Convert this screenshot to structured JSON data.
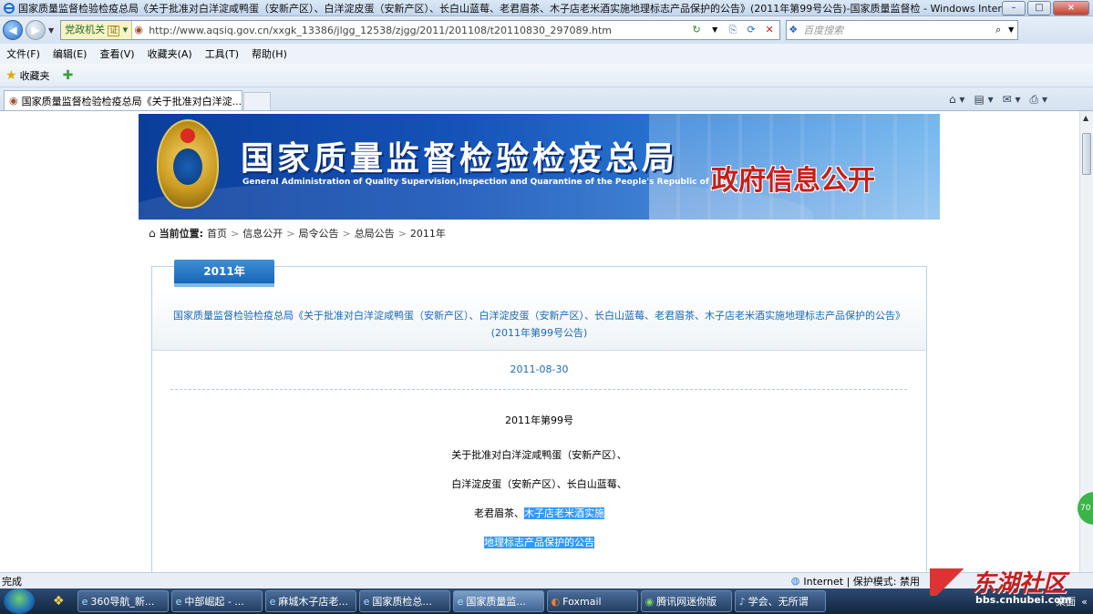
{
  "window": {
    "title": "国家质量监督检验检疫总局《关于批准对白洋淀咸鸭蛋（安新产区）、白洋淀皮蛋（安新产区）、长白山蓝莓、老君眉茶、木子店老米酒实施地理标志产品保护的公告》(2011年第99号公告)-国家质量监督检 - Windows Internet E...",
    "minimize": "–",
    "maximize": "□",
    "close": "×"
  },
  "address": {
    "gov_label": "党政机关",
    "cert_label": "证",
    "url": "http://www.aqsiq.gov.cn/xxgk_13386/jlgg_12538/zjgg/2011/201108/t20110830_297089.htm",
    "search_placeholder": "百度搜索"
  },
  "menu": [
    "文件(F)",
    "编辑(E)",
    "查看(V)",
    "收藏夹(A)",
    "工具(T)",
    "帮助(H)"
  ],
  "favorites": {
    "label": "收藏夹"
  },
  "tab": {
    "label": "国家质量监督检验检疫总局《关于批准对白洋淀..."
  },
  "banner": {
    "title_cn": "国家质量监督检验检疫总局",
    "title_en": "General Administration of Quality Supervision,Inspection and Quarantine of the People's Republic of China",
    "gov_open": "政府信息公开"
  },
  "breadcrumb": {
    "label": "当前位置:",
    "items": [
      "首页",
      "信息公开",
      "局令公告",
      "总局公告",
      "2011年"
    ]
  },
  "panel": {
    "year_tab": "2011年",
    "headline": "国家质量监督检验检疫总局《关于批准对白洋淀咸鸭蛋（安新产区）、白洋淀皮蛋（安新产区）、长白山蓝莓、老君眉茶、木子店老米酒实施地理标志产品保护的公告》(2011年第99号公告)",
    "date": "2011-08-30",
    "number": "2011年第99号",
    "line1": "关于批准对白洋淀咸鸭蛋（安新产区）、",
    "line2": "白洋淀皮蛋（安新产区）、长白山蓝莓、",
    "line3_plain": "老君眉茶、",
    "line3_hl": "木子店老米酒实施",
    "line4_hl": "地理标志产品保护的公告"
  },
  "status": {
    "left": "完成",
    "zone": "Internet | 保护模式: 禁用"
  },
  "taskbar": {
    "buttons": [
      {
        "label": "360导航_新..."
      },
      {
        "label": "中部崛起 - ..."
      },
      {
        "label": "麻城木子店老..."
      },
      {
        "label": "国家质检总..."
      },
      {
        "label": "国家质量监..."
      },
      {
        "label": "Foxmail"
      },
      {
        "label": "腾讯网迷你版"
      },
      {
        "label": "学会、无所谓"
      }
    ],
    "tray_label": "桌面",
    "watermark_main": "东湖社区",
    "watermark_sub": "bbs.cnhubei.com",
    "side_badge": "70"
  }
}
